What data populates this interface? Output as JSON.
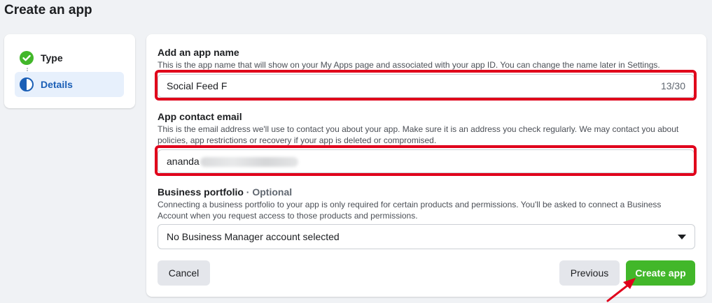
{
  "page": {
    "title": "Create an app"
  },
  "steps": [
    {
      "label": "Type",
      "status": "complete"
    },
    {
      "label": "Details",
      "status": "current"
    }
  ],
  "app_name": {
    "label": "Add an app name",
    "help": "This is the app name that will show on your My Apps page and associated with your app ID. You can change the name later in Settings.",
    "value": "Social Feed F",
    "counter": "13/30"
  },
  "contact_email": {
    "label": "App contact email",
    "help": "This is the email address we'll use to contact you about your app. Make sure it is an address you check regularly. We may contact you about policies, app restrictions or recovery if your app is deleted or compromised.",
    "value_visible": "ananda"
  },
  "business_portfolio": {
    "label": "Business portfolio",
    "optional": "· Optional",
    "help": "Connecting a business portfolio to your app is only required for certain products and permissions. You'll be asked to connect a Business Account when you request access to those products and permissions.",
    "selected": "No Business Manager account selected"
  },
  "actions": {
    "cancel": "Cancel",
    "previous": "Previous",
    "create": "Create app"
  },
  "colors": {
    "accent_blue": "#1b5fb6",
    "success_green": "#42b72a",
    "highlight_red": "#e0001b"
  }
}
